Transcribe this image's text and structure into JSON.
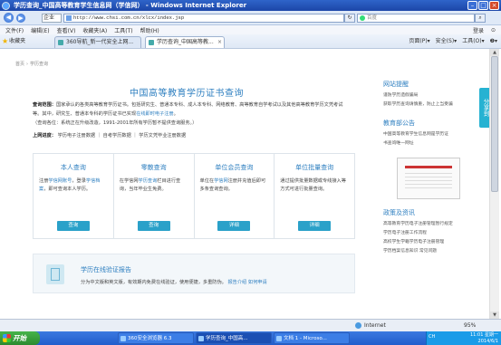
{
  "window": {
    "title": "学历查询_中国高等教育学生信息网（学信网） - Windows Internet Explorer"
  },
  "addressbar": {
    "back_icon": "back-arrow-icon",
    "forward_icon": "forward-arrow-icon",
    "company_select": "企业",
    "url": "http://www.chsi.com.cn/xlcx/index.jsp",
    "search_placeholder": "百度"
  },
  "menu": {
    "items": [
      "文件(F)",
      "编辑(E)",
      "查看(V)",
      "收藏夹(A)",
      "工具(T)",
      "帮助(H)"
    ],
    "right": [
      "登录",
      "⊙"
    ]
  },
  "favbar": {
    "favorites_label": "收藏夹",
    "tabs": [
      {
        "label": "360导航_新一代安全上网..."
      },
      {
        "label": "学历查询_中国高等教..."
      }
    ],
    "toolbar_right": [
      "页面(P)▾",
      "安全(S)▾",
      "工具(O)▾",
      "❷▾"
    ]
  },
  "page": {
    "breadcrumb": [
      "首页",
      "学历查询"
    ],
    "title": "中国高等教育学历证书查询",
    "scope_label": "查询范围：",
    "scope_text": "国家承认的各类高等教育学历证书。包括研究生、普通本专科、成人本专科、网络教育、高等教育自学考试以及其他高等教育学历文凭考试等。其中，研究生、普通本专科的学历证书已实现",
    "scope_link": "在线即时电子注册",
    "scope_note": "（查询各位：系统正在升级改造，1991-2001年所有学历暂不提供查询服务。）",
    "entrance_label": "上网进度：",
    "entrances": [
      "学历电子注册数据",
      "自考学历数据",
      "学历文凭毕业注册数据"
    ],
    "cards": [
      {
        "title": "本人查询",
        "desc_prefix": "注册",
        "desc_link1": "学信网账号",
        "desc_mid": "，登录",
        "desc_link2": "学信档案",
        "desc_suffix": "，即可查询本人学历。",
        "button": "查询"
      },
      {
        "title": "零散查询",
        "desc_prefix": "在学信网",
        "desc_link1": "学历查询",
        "desc_suffix": "栏目进行查询，当年毕业生免费。",
        "button": "查询"
      },
      {
        "title": "单位会员查询",
        "desc_prefix": "单位在",
        "desc_link1": "学信网",
        "desc_suffix": "注册并充值后即可多条查询查询。",
        "button": "详细"
      },
      {
        "title": "单位批量查询",
        "desc_prefix": "通过提供批量数据或专线接入等方式可进行批量查询。",
        "button": "详细"
      }
    ],
    "verify": {
      "title": "学历在线验证报告",
      "desc": "分为中文版和英文版，有效期内免费在线验证，使用便捷，多重防伪。",
      "link1": "报告介绍",
      "link2": "如何申请"
    },
    "share_tab": "分享到",
    "sidebar": {
      "sections": [
        {
          "title": "网站提醒",
          "items": [
            "谨防学历造假骗局",
            "获取学历查询请慎重，防止上当受骗"
          ]
        },
        {
          "title": "教育部公告",
          "items": [
            "中国高等教育学生信息网是学历证",
            "书查询唯一网址"
          ]
        },
        {
          "title": "政策及资讯",
          "items": [
            "高等教育学历电子注册管理暂行规定",
            "学历电子注册工作流程",
            "高校学生学籍学历电子注册管理",
            "学历档案信息知识  常见问题"
          ]
        }
      ]
    }
  },
  "statusbar": {
    "zone": "Internet",
    "zoom": "95%"
  },
  "taskbar": {
    "start": "开始",
    "items": [
      "360安全浏览器 6.3",
      "学历查询_中国高...",
      "文档 1 - Microso..."
    ],
    "lang": "CH",
    "clock_time": "11:01",
    "clock_day": "星期一",
    "clock_date": "2014/6/1"
  }
}
